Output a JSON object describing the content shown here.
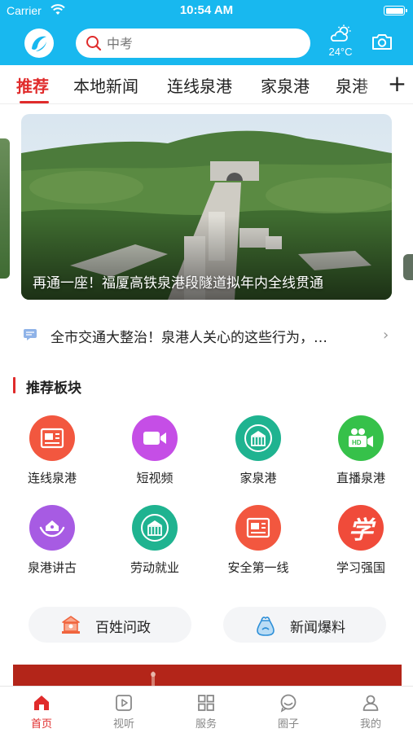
{
  "status_bar": {
    "carrier": "Carrier",
    "time": "10:54 AM"
  },
  "header": {
    "search_placeholder": "中考",
    "weather_temp": "24°C"
  },
  "tabs": [
    {
      "label": "推荐",
      "active": true
    },
    {
      "label": "本地新闻",
      "active": false
    },
    {
      "label": "连线泉港",
      "active": false
    },
    {
      "label": "家泉港",
      "active": false
    },
    {
      "label": "泉港",
      "active": false
    }
  ],
  "tab_add_label": "+",
  "banner": {
    "caption": "再通一座！福厦高铁泉港段隧道拟年内全线贯通"
  },
  "notice": {
    "text": "全市交通大整治！泉港人关心的这些行为，…"
  },
  "section": {
    "title": "推荐板块"
  },
  "grid": [
    {
      "label": "连线泉港",
      "icon": "newspaper-icon",
      "color": "#f2573f"
    },
    {
      "label": "短视频",
      "icon": "video-camera-icon",
      "color": "#c54ee6"
    },
    {
      "label": "家泉港",
      "icon": "building-icon",
      "color": "#1fb390"
    },
    {
      "label": "直播泉港",
      "icon": "hd-camera-icon",
      "color": "#36c14a"
    },
    {
      "label": "泉港讲古",
      "icon": "house-hand-icon",
      "color": "#a75be3"
    },
    {
      "label": "劳动就业",
      "icon": "building-icon",
      "color": "#1fb390"
    },
    {
      "label": "安全第一线",
      "icon": "newspaper-icon",
      "color": "#f2573f"
    },
    {
      "label": "学习强国",
      "icon": "xue-char-icon",
      "color": "#f04b3a",
      "glyph": "学"
    }
  ],
  "pills": [
    {
      "label": "百姓问政",
      "icon": "gov-building-icon"
    },
    {
      "label": "新闻爆料",
      "icon": "megaphone-bag-icon"
    }
  ],
  "bottom_nav": [
    {
      "label": "首页",
      "active": true
    },
    {
      "label": "视听",
      "active": false
    },
    {
      "label": "服务",
      "active": false
    },
    {
      "label": "圈子",
      "active": false
    },
    {
      "label": "我的",
      "active": false
    }
  ],
  "colors": {
    "header": "#18b8ef",
    "accent": "#e02b2b"
  }
}
